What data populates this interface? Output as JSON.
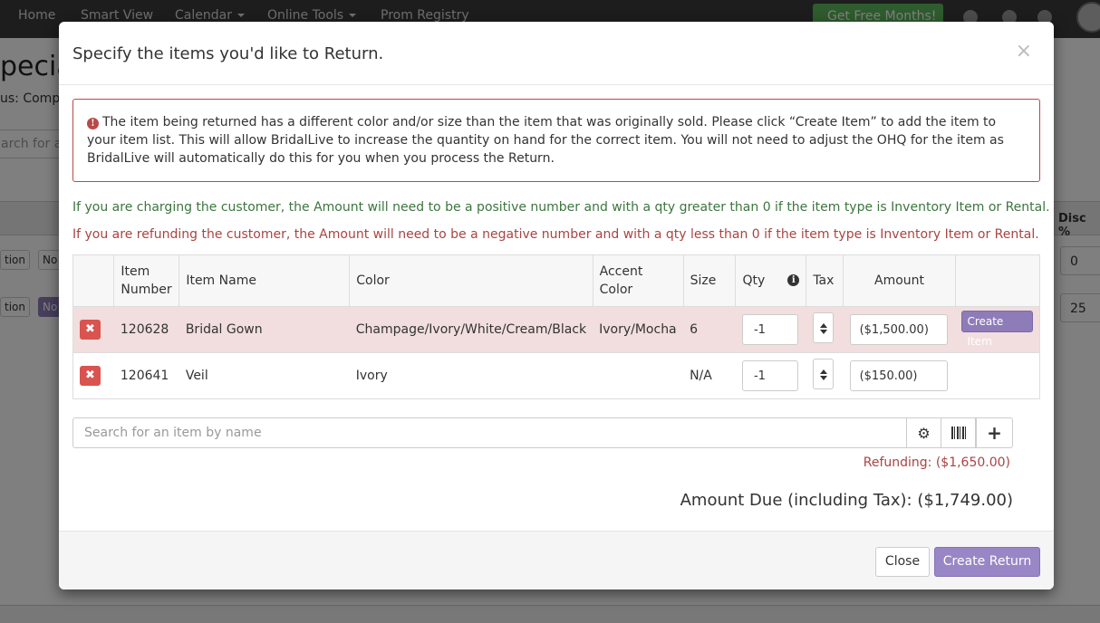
{
  "background": {
    "nav": {
      "items": [
        "Home",
        "Smart View",
        "Calendar",
        "Online Tools",
        "Prom Registry"
      ],
      "free_months": "Get Free Months!"
    },
    "title_fragment": "pecial",
    "status_fragment": "us: Comple",
    "search_fragment": "arch for a",
    "disc_header": "Disc %",
    "pill_label": "tion",
    "pill_right": "No",
    "disc_values": [
      "0",
      "25"
    ]
  },
  "modal": {
    "title": "Specify the items you'd like to Return.",
    "close_x": "×",
    "alert": {
      "icon": "exclamation-circle-icon",
      "text": "The item being returned has a different color and/or size than the item that was originally sold. Please click “Create Item” to add the item to your item list. This will allow BridalLive to increase the quantity on hand for the correct item. You will not need to adjust the OHQ for the item as BridalLive will automatically do this for you when you process the Return."
    },
    "note_charging": "If you are charging the customer, the Amount will need to be a positive number and with a qty greater than 0 if the item type is Inventory Item or Rental.",
    "note_refunding": "If you are refunding the customer, the Amount will need to be a negative number and with a qty less than 0 if the item type is Inventory Item or Rental.",
    "table": {
      "headers": {
        "item_number": "Item Number",
        "item_name": "Item Name",
        "color": "Color",
        "accent_color": "Accent Color",
        "size": "Size",
        "qty": "Qty",
        "tax": "Tax",
        "amount": "Amount"
      },
      "rows": [
        {
          "item_number": "120628",
          "item_name": "Bridal Gown",
          "color": "Champage/Ivory/White/Cream/Black",
          "accent_color": "Ivory/Mocha",
          "size": "6",
          "qty": "-1",
          "amount": "($1,500.00)",
          "action": "Create Item"
        },
        {
          "item_number": "120641",
          "item_name": "Veil",
          "color": "Ivory",
          "accent_color": "",
          "size": "N/A",
          "qty": "-1",
          "amount": "($150.00)",
          "action": ""
        }
      ]
    },
    "search": {
      "placeholder": "Search for an item by name"
    },
    "refunding": "Refunding: ($1,650.00)",
    "amount_due": "Amount Due (including Tax): ($1,749.00)",
    "footer": {
      "close": "Close",
      "create_return": "Create Return"
    }
  },
  "colors": {
    "danger": "#d9534f",
    "success_text": "#3c763d",
    "danger_text": "#a94442",
    "purple_button": "#9886c6",
    "warning_row": "#f2dede"
  }
}
